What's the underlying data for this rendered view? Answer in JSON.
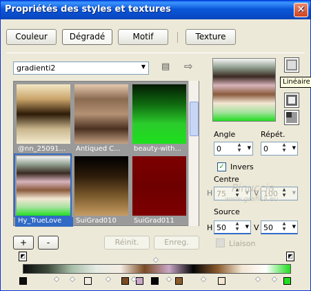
{
  "window": {
    "title": "Propriétés des styles et textures",
    "close_glyph": "✕"
  },
  "tabs": [
    {
      "label": "Couleur"
    },
    {
      "label": "Dégradé"
    },
    {
      "label": "Motif"
    },
    {
      "label": "Texture"
    }
  ],
  "gradient_select": {
    "value": "gradienti2"
  },
  "gallery": {
    "items": [
      {
        "caption": "@nn_25091...",
        "colors": [
          "#f3e7c4",
          "#c9a46a",
          "#2d1a07",
          "#c8b58d",
          "#f5ecd0"
        ]
      },
      {
        "caption": "Antiqued C...",
        "colors": [
          "#e5c9ae",
          "#8a6a50",
          "#b39174",
          "#4a3020",
          "#c4a384"
        ]
      },
      {
        "caption": "beauty-with...",
        "colors": [
          "#041a04",
          "#0f6a0f",
          "#2ccc2c",
          "#1de01d"
        ]
      },
      {
        "caption": "Hy_TrueLove",
        "colors": [
          "#f5f5f5",
          "#8d9c8c",
          "#3a2a22",
          "#d8b4bc",
          "#8a5a3c",
          "#f3e6d3",
          "#a7e2a0",
          "#22dd22"
        ]
      },
      {
        "caption": "SuiGrad010",
        "colors": [
          "#000000",
          "#2c1b0a",
          "#7a5a2c",
          "#c69c62"
        ]
      },
      {
        "caption": "SuiGrad011",
        "colors": [
          "#7d0000",
          "#6d0000",
          "#7d0000"
        ]
      }
    ]
  },
  "buttons": {
    "add": "+",
    "remove": "-",
    "reset": "Réinit.",
    "save": "Enreg."
  },
  "style_tooltip": "Linéaire",
  "angle": {
    "label": "Angle",
    "value": "0"
  },
  "repeat": {
    "label": "Répét.",
    "value": "0"
  },
  "invert": {
    "label": "Invers",
    "checked": true
  },
  "center": {
    "label": "Centre",
    "h_label": "H",
    "h_value": "75",
    "v_label": "V",
    "v_value": "100"
  },
  "source": {
    "label": "Source",
    "h_label": "H",
    "h_value": "50",
    "v_label": "V",
    "v_value": "50"
  },
  "link": {
    "label": "Liaison",
    "checked": false
  },
  "watermark": {
    "line1": "Pinuccia",
    "line2": "www.grafica.eu"
  },
  "gradient_bar": {
    "stops": [
      "#0d0d0d",
      "#3d4a3a",
      "#a7bfa9",
      "#e6ebe3",
      "#f4ece2",
      "#7a4a22",
      "#c9a7c7",
      "#050505",
      "#8a5a2c",
      "#f3e6d3",
      "#ffffff",
      "#22dd22"
    ]
  },
  "icons": {
    "grid_icon": "▤",
    "arrow_icon": "⇨",
    "dropdown_icon": "▼"
  }
}
